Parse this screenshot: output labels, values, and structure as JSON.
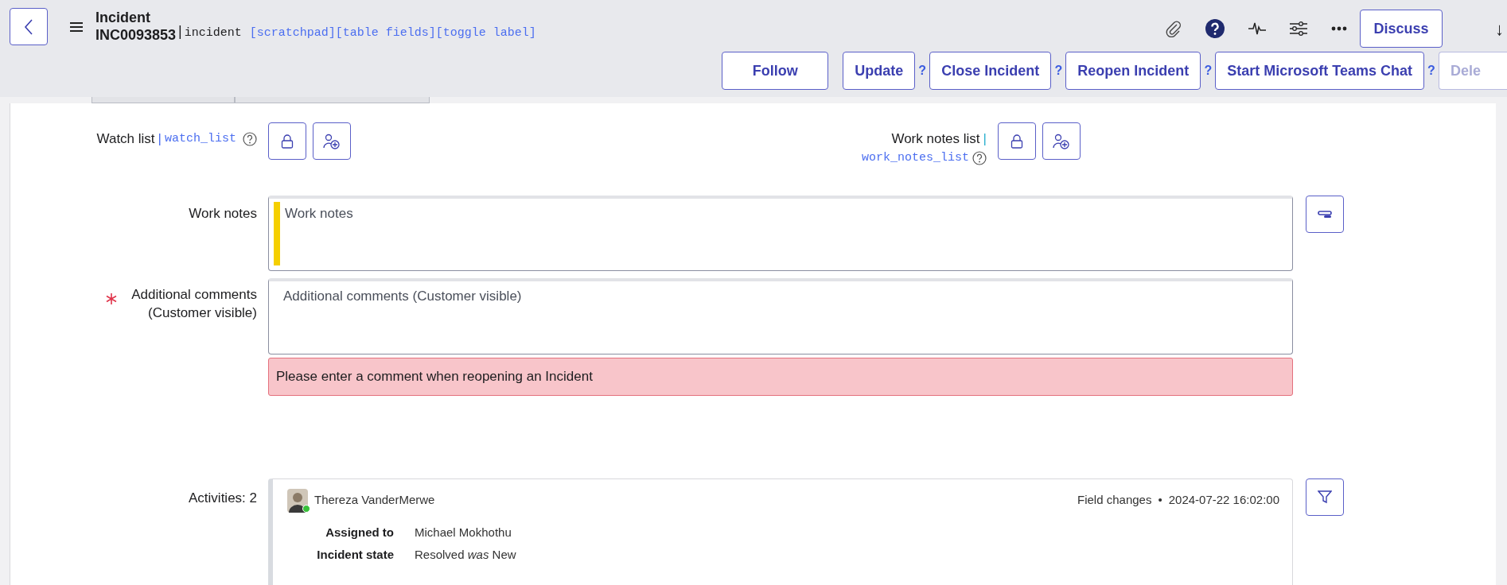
{
  "header": {
    "title": "Incident",
    "number": "INC0093853",
    "separator": "|",
    "table_name": "incident",
    "links": [
      "[scratchpad]",
      "[table fields]",
      "[toggle label]"
    ],
    "discuss_button": "Discuss",
    "arrow": "↓"
  },
  "actions": [
    {
      "label": "Follow"
    },
    {
      "label": "Update",
      "help": "?"
    },
    {
      "label": "Close Incident",
      "help": "?"
    },
    {
      "label": "Reopen Incident",
      "help": "?"
    },
    {
      "label": "Start Microsoft Teams Chat",
      "help": "?"
    },
    {
      "label": "Dele"
    }
  ],
  "watch_lists": [
    {
      "label": "Watch list",
      "separator": "|",
      "field_name": "watch_list"
    },
    {
      "label": "Work notes list",
      "separator": "|",
      "field_name": "work_notes_list"
    }
  ],
  "work_notes": {
    "label": "Work notes",
    "placeholder": "Work notes"
  },
  "comments": {
    "label": "Additional comments (Customer visible)",
    "mandatory": true,
    "placeholder": "Additional comments (Customer visible)",
    "error": "Please enter a comment when reopening an Incident"
  },
  "activities": {
    "label": "Activities: 2",
    "entries": [
      {
        "author": "Thereza VanderMerwe",
        "online": true,
        "type": "Field changes",
        "separator": "•",
        "timestamp": "2024-07-22 16:02:00",
        "changes": [
          {
            "field": "Assigned to",
            "value": "Michael Mokhothu"
          },
          {
            "field": "Incident state",
            "value": "Resolved *was* New"
          }
        ]
      }
    ]
  }
}
